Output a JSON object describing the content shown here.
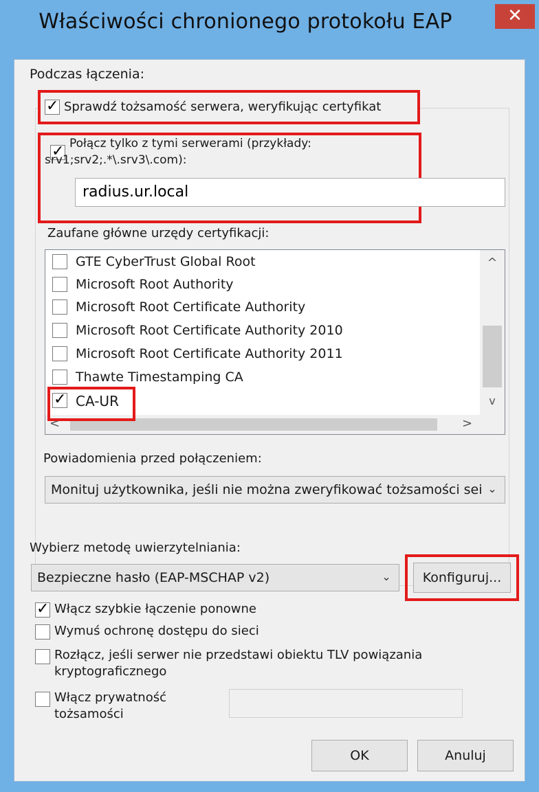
{
  "window": {
    "title": "Właściwości chronionego protokołu EAP",
    "close_glyph": "✕"
  },
  "connecting": {
    "heading": "Podczas łączenia:",
    "verify_server_cert": {
      "label": "Sprawdź tożsamość serwera, weryfikując certyfikat",
      "checked": true
    },
    "connect_only": {
      "label_line1": "Połącz tylko z tymi serwerami (przykłady:",
      "label_line2": "srv1;srv2;.*\\.srv3\\.com):",
      "checked": true
    },
    "server_value": "radius.ur.local",
    "trusted_ca_label": "Zaufane główne urzędy certyfikacji:",
    "ca_list": [
      {
        "name": "GTE CyberTrust Global Root",
        "checked": false
      },
      {
        "name": "Microsoft Root Authority",
        "checked": false
      },
      {
        "name": "Microsoft Root Certificate Authority",
        "checked": false
      },
      {
        "name": "Microsoft Root Certificate Authority 2010",
        "checked": false
      },
      {
        "name": "Microsoft Root Certificate Authority 2011",
        "checked": false
      },
      {
        "name": "Thawte Timestamping CA",
        "checked": false
      },
      {
        "name": "CA-UR",
        "checked": true
      }
    ],
    "notifications_label": "Powiadomienia przed połączeniem:",
    "notifications_value": "Monituj użytkownika, jeśli nie można zweryfikować tożsamości sei"
  },
  "auth": {
    "label": "Wybierz metodę uwierzytelniania:",
    "method_value": "Bezpieczne hasło (EAP-MSCHAP v2)",
    "configure_label": "Konfiguruj..."
  },
  "options": {
    "fast_reconnect": {
      "label": "Włącz szybkie łączenie ponowne",
      "checked": true
    },
    "nap": {
      "label": "Wymuś ochronę dostępu do sieci",
      "checked": false
    },
    "disconnect_tlv": {
      "label_line1": "Rozłącz, jeśli serwer nie przedstawi obiektu TLV powiązania",
      "label_line2": "kryptograficznego",
      "checked": false
    },
    "identity_privacy": {
      "label_line1": "Włącz prywatność",
      "label_line2": "tożsamości",
      "checked": false
    }
  },
  "buttons": {
    "ok": "OK",
    "cancel": "Anuluj"
  },
  "scroll": {
    "up": "^",
    "down": "v",
    "left": "<",
    "right": ">"
  },
  "colors": {
    "title_bar": "#6fb0e5",
    "close": "#c7433a",
    "highlight": "#e31a1a"
  }
}
